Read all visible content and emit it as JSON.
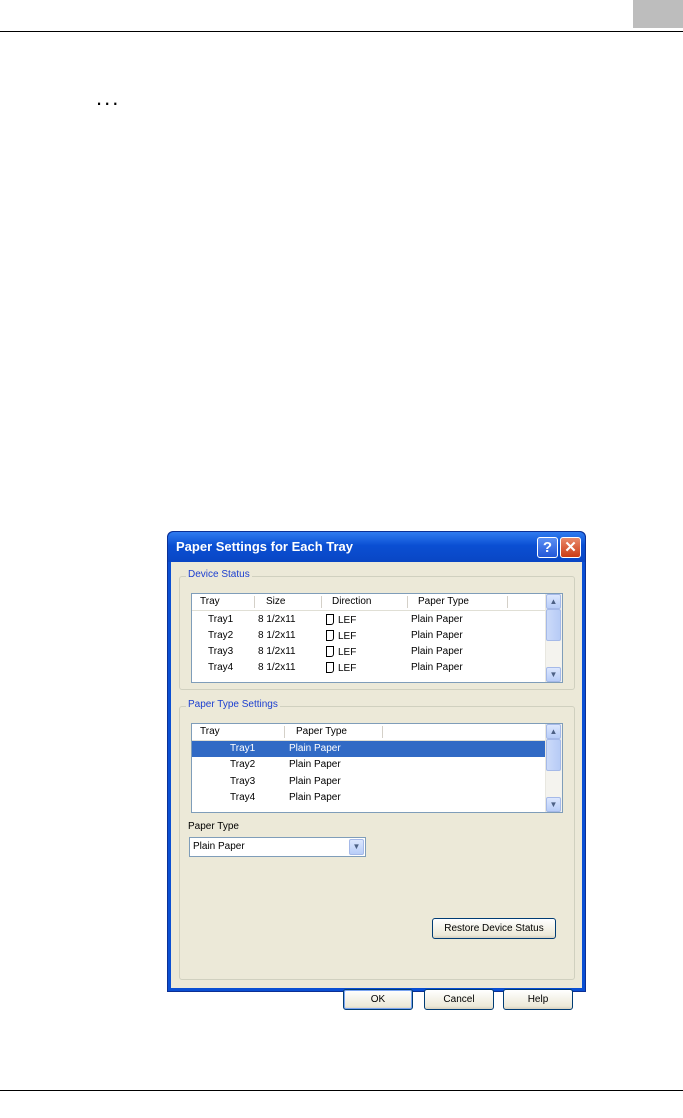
{
  "page": {
    "ellipsis": "..."
  },
  "dialog": {
    "title": "Paper Settings for Each Tray",
    "help_glyph": "?",
    "close_glyph": "✕",
    "device_status": {
      "legend": "Device Status",
      "columns": [
        "Tray",
        "Size",
        "Direction",
        "Paper Type"
      ],
      "rows": [
        {
          "tray": "Tray1",
          "size": "8 1/2x11",
          "direction": "LEF",
          "paper_type": "Plain Paper"
        },
        {
          "tray": "Tray2",
          "size": "8 1/2x11",
          "direction": "LEF",
          "paper_type": "Plain Paper"
        },
        {
          "tray": "Tray3",
          "size": "8 1/2x11",
          "direction": "LEF",
          "paper_type": "Plain Paper"
        },
        {
          "tray": "Tray4",
          "size": "8 1/2x11",
          "direction": "LEF",
          "paper_type": "Plain Paper"
        }
      ]
    },
    "paper_type_settings": {
      "legend": "Paper Type Settings",
      "columns": [
        "Tray",
        "Paper Type"
      ],
      "rows": [
        {
          "tray": "Tray1",
          "paper_type": "Plain Paper",
          "selected": true
        },
        {
          "tray": "Tray2",
          "paper_type": "Plain Paper"
        },
        {
          "tray": "Tray3",
          "paper_type": "Plain Paper"
        },
        {
          "tray": "Tray4",
          "paper_type": "Plain Paper"
        }
      ],
      "paper_type_label": "Paper Type",
      "paper_type_value": "Plain Paper",
      "restore_button": "Restore Device Status"
    },
    "buttons": {
      "ok": "OK",
      "cancel": "Cancel",
      "help": "Help"
    }
  }
}
